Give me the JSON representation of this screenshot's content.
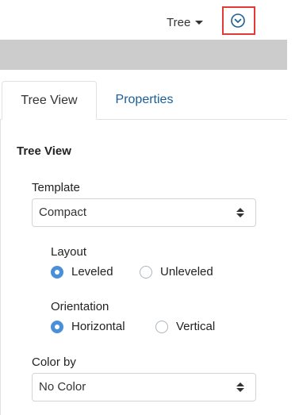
{
  "topbar": {
    "view_dropdown_label": "Tree",
    "collapse_icon": "chevron-down-circle-icon",
    "highlight_color": "#e53935"
  },
  "tabs": [
    {
      "label": "Tree View",
      "active": true
    },
    {
      "label": "Properties",
      "active": false
    }
  ],
  "section": {
    "title": "Tree View"
  },
  "template": {
    "label": "Template",
    "value": "Compact"
  },
  "layout": {
    "label": "Layout",
    "options": [
      {
        "label": "Leveled",
        "checked": true
      },
      {
        "label": "Unleveled",
        "checked": false
      }
    ]
  },
  "orientation": {
    "label": "Orientation",
    "options": [
      {
        "label": "Horizontal",
        "checked": true
      },
      {
        "label": "Vertical",
        "checked": false
      }
    ]
  },
  "color_by": {
    "label": "Color by",
    "value": "No Color"
  },
  "colors": {
    "accent": "#4a90d9",
    "link": "#1a5e96",
    "strip": "#cccccc"
  }
}
